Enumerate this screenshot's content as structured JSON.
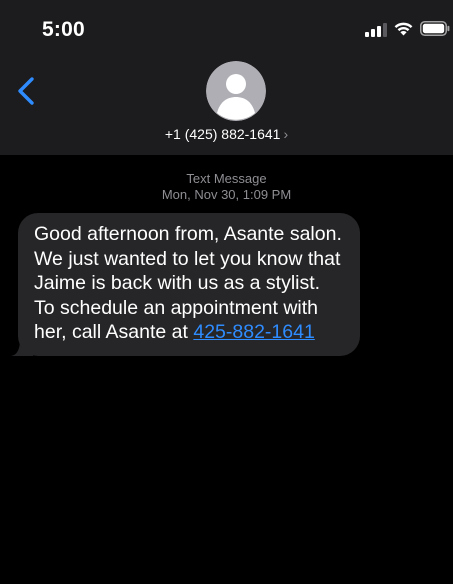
{
  "status_bar": {
    "time": "5:00"
  },
  "header": {
    "contact_number": "+1 (425) 882-1641",
    "chevron": "›"
  },
  "message_meta": {
    "type": "Text Message",
    "timestamp": "Mon, Nov 30, 1:09 PM"
  },
  "message": {
    "text_before_link": "Good afternoon from, Asante salon. We just wanted to let you know that Jaime is back with us as a stylist. To schedule an appointment with her, call Asante at ",
    "link_text": "425-882-1641"
  },
  "icons": {
    "back": "chevron-left-icon",
    "avatar": "person-icon",
    "signal": "cellular-signal-icon",
    "wifi": "wifi-icon",
    "battery": "battery-icon"
  },
  "colors": {
    "background": "#000000",
    "header_background": "#1c1c1e",
    "bubble": "#262628",
    "accent": "#2f8cff",
    "secondary_text": "#8e8e93"
  }
}
